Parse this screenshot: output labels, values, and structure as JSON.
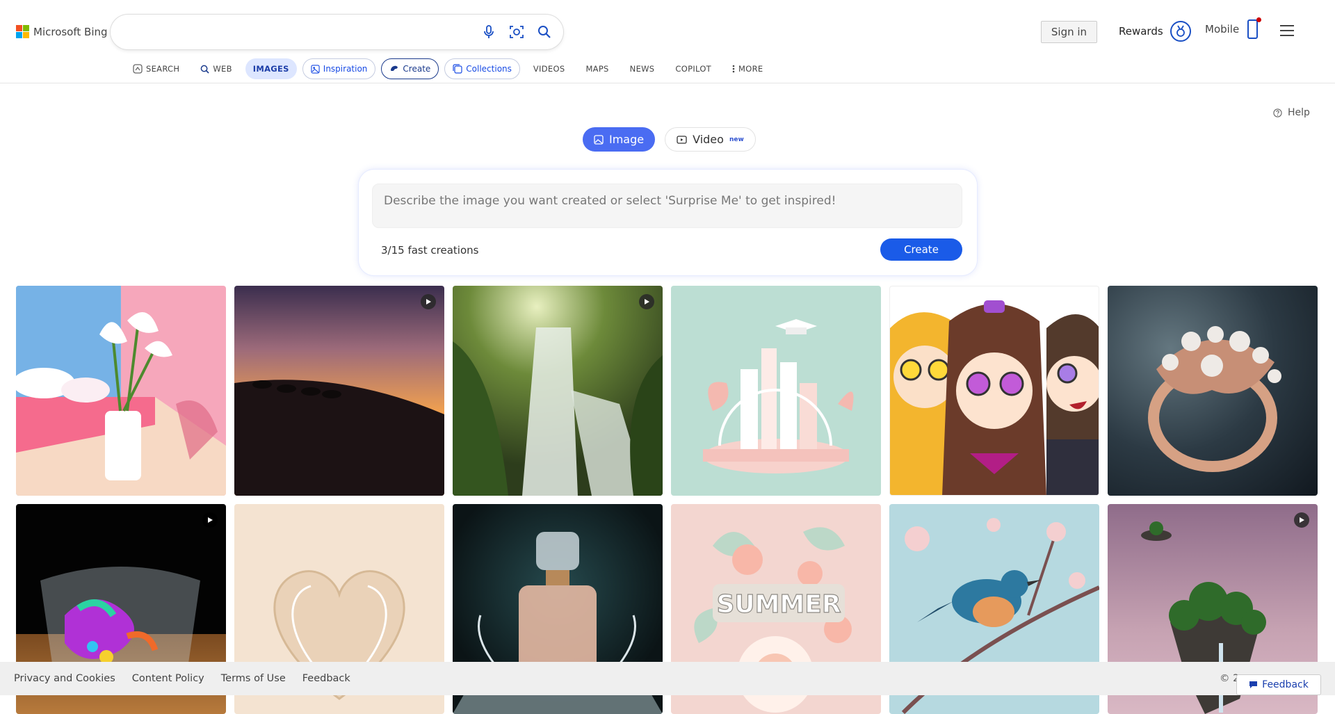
{
  "brand": {
    "name": "Microsoft Bing",
    "colors": [
      "#f25022",
      "#7fba00",
      "#00a4ef",
      "#ffb900"
    ]
  },
  "search": {
    "placeholder": ""
  },
  "header": {
    "sign_in": "Sign in",
    "rewards": "Rewards",
    "mobile": "Mobile"
  },
  "nav": [
    {
      "label": "SEARCH",
      "icon": "copilot-icon"
    },
    {
      "label": "WEB",
      "icon": "search-icon"
    },
    {
      "label": "IMAGES"
    },
    {
      "label": "Inspiration",
      "icon": "inspiration-icon"
    },
    {
      "label": "Create",
      "icon": "create-icon"
    },
    {
      "label": "Collections",
      "icon": "collections-icon"
    },
    {
      "label": "VIDEOS"
    },
    {
      "label": "MAPS"
    },
    {
      "label": "NEWS"
    },
    {
      "label": "COPILOT"
    },
    {
      "label": "MORE",
      "icon": "more-icon"
    }
  ],
  "help": "Help",
  "mode": {
    "image": "Image",
    "video": "Video",
    "video_badge": "new"
  },
  "create": {
    "placeholder": "Describe the image you want created or select 'Surprise Me' to get inspired!",
    "count": "3/15 fast creations",
    "button": "Create"
  },
  "gallery": [
    {
      "subject": "calla-lilies",
      "video": false
    },
    {
      "subject": "desert-camels-sunset",
      "video": true
    },
    {
      "subject": "forest-waterfall",
      "video": true
    },
    {
      "subject": "paper-city-graduation",
      "video": false
    },
    {
      "subject": "anime-friends",
      "video": false
    },
    {
      "subject": "pearl-ring",
      "video": false
    },
    {
      "subject": "rainbow-glass",
      "video": true
    },
    {
      "subject": "paper-heart",
      "video": false
    },
    {
      "subject": "perfume-bottle",
      "video": false
    },
    {
      "subject": "paper-summer-flowers",
      "video": false
    },
    {
      "subject": "bird-on-blossom",
      "video": false
    },
    {
      "subject": "floating-island",
      "video": true
    }
  ],
  "footer": {
    "links": [
      "Privacy and Cookies",
      "Content Policy",
      "Terms of Use",
      "Feedback"
    ],
    "copyright": "© 2",
    "feedback_button": "Feedback"
  }
}
